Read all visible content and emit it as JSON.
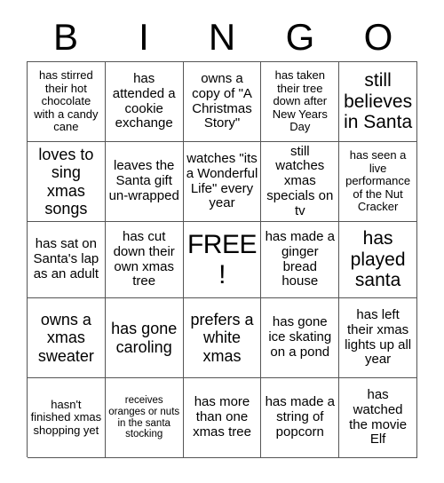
{
  "header": {
    "letters": [
      "B",
      "I",
      "N",
      "G",
      "O"
    ]
  },
  "grid": {
    "columns": 5,
    "rows": 5,
    "free_space_index": 12,
    "cells": [
      {
        "text": "has stirred their hot chocolate with a candy cane",
        "size": "sz-s"
      },
      {
        "text": "has attended a cookie exchange",
        "size": "sz-m"
      },
      {
        "text": "owns a copy of \"A Christmas Story\"",
        "size": "sz-m"
      },
      {
        "text": "has taken their tree down after New Years Day",
        "size": "sz-s"
      },
      {
        "text": "still believes in Santa",
        "size": "sz-xl"
      },
      {
        "text": "loves to sing xmas songs",
        "size": "sz-l"
      },
      {
        "text": "leaves the Santa gift un-wrapped",
        "size": "sz-m"
      },
      {
        "text": "watches \"its a Wonderful Life\" every year",
        "size": "sz-m"
      },
      {
        "text": "still watches xmas specials on tv",
        "size": "sz-m"
      },
      {
        "text": "has seen a live performance of the Nut Cracker",
        "size": "sz-s"
      },
      {
        "text": "has sat on Santa's lap as an adult",
        "size": "sz-m"
      },
      {
        "text": "has cut down their own xmas tree",
        "size": "sz-m"
      },
      {
        "text": "FREE!",
        "size": "sz-free"
      },
      {
        "text": "has made a ginger bread house",
        "size": "sz-m"
      },
      {
        "text": "has played santa",
        "size": "sz-xl"
      },
      {
        "text": "owns a xmas sweater",
        "size": "sz-l"
      },
      {
        "text": "has gone caroling",
        "size": "sz-l"
      },
      {
        "text": "prefers a white xmas",
        "size": "sz-l"
      },
      {
        "text": "has gone ice skating on a pond",
        "size": "sz-m"
      },
      {
        "text": "has left their xmas lights up all year",
        "size": "sz-m"
      },
      {
        "text": "hasn't finished xmas shopping yet",
        "size": "sz-s"
      },
      {
        "text": "receives oranges or nuts in the santa stocking",
        "size": "sz-xs"
      },
      {
        "text": "has more than one xmas tree",
        "size": "sz-m"
      },
      {
        "text": "has made a string of popcorn",
        "size": "sz-m"
      },
      {
        "text": "has watched the movie Elf",
        "size": "sz-m"
      }
    ]
  },
  "colors": {
    "background": "#ffffff",
    "border": "#555555",
    "text": "#000000"
  }
}
